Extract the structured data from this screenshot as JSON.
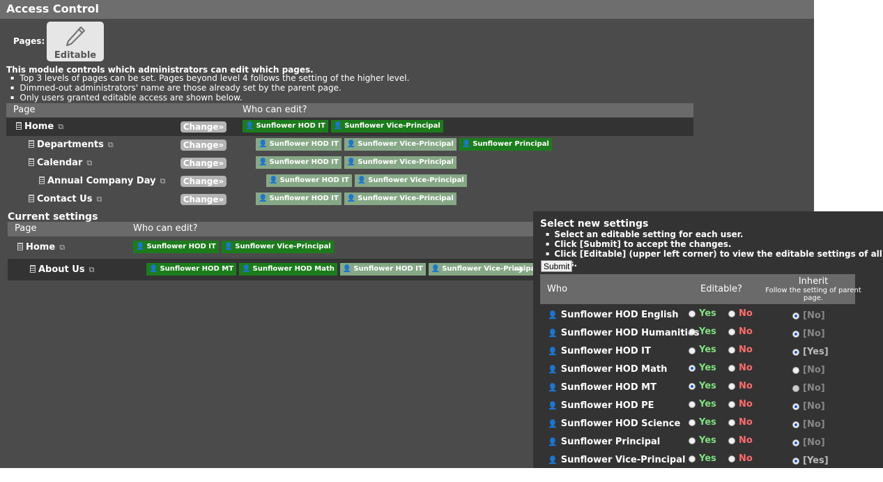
{
  "app": {
    "title": "Access Control"
  },
  "toolbar": {
    "pages_label": "Pages:",
    "editable_label": "Editable"
  },
  "intro": {
    "heading": "This module controls which administrators can edit which pages.",
    "bullets": [
      "Top 3 levels of pages can be set. Pages beyond level 4 follows the setting of the higher level.",
      "Dimmed-out administrators' name are those already set by the parent page.",
      "Only users granted editable access are shown below."
    ]
  },
  "pages_table": {
    "col_page": "Page",
    "col_who": "Who can edit?",
    "change_label": "Change»",
    "rows": [
      {
        "name": "Home",
        "tags": [
          {
            "label": "Sunflower HOD IT"
          },
          {
            "label": "Sunflower Vice-Principal"
          }
        ]
      },
      {
        "name": "Departments",
        "tags": [
          {
            "label": "Sunflower HOD IT"
          },
          {
            "label": "Sunflower Vice-Principal"
          },
          {
            "label": "Sunflower Principal"
          }
        ]
      },
      {
        "name": "Calendar",
        "tags": [
          {
            "label": "Sunflower HOD IT"
          },
          {
            "label": "Sunflower Vice-Principal"
          }
        ]
      },
      {
        "name": "Annual Company Day",
        "tags": [
          {
            "label": "Sunflower HOD IT"
          },
          {
            "label": "Sunflower Vice-Principal"
          }
        ]
      },
      {
        "name": "Contact Us",
        "tags": [
          {
            "label": "Sunflower HOD IT"
          },
          {
            "label": "Sunflower Vice-Principal"
          }
        ]
      }
    ]
  },
  "current": {
    "title": "Current settings",
    "col_page": "Page",
    "col_who": "Who can edit?",
    "rows": [
      {
        "name": "Home",
        "tags": [
          {
            "label": "Sunflower HOD IT"
          },
          {
            "label": "Sunflower Vice-Principal"
          }
        ]
      },
      {
        "name": "About Us",
        "tags": [
          {
            "label": "Sunflower HOD MT"
          },
          {
            "label": "Sunflower HOD Math"
          },
          {
            "label": "Sunflower HOD IT"
          },
          {
            "label": "Sunflower Vice-Principal"
          }
        ]
      }
    ]
  },
  "panel": {
    "title": "Select new settings",
    "bullets": [
      "Select an editable setting for each user.",
      "Click [Submit] to accept the changes.",
      "Click [Editable] (upper left corner) to view the editable settings of all pages."
    ],
    "submit_label": "Submit",
    "col_who": "Who",
    "col_editable": "Editable?",
    "col_inherit": "Inherit",
    "col_inherit_sub": "Follow the setting of parent page.",
    "yes_label": "Yes",
    "no_label": "No",
    "users": [
      {
        "name": "Sunflower HOD English",
        "inherit_value": "[No]"
      },
      {
        "name": "Sunflower HOD Humanities",
        "inherit_value": "[No]"
      },
      {
        "name": "Sunflower HOD IT",
        "inherit_value": "[Yes]"
      },
      {
        "name": "Sunflower HOD Math",
        "inherit_value": "[No]"
      },
      {
        "name": "Sunflower HOD MT",
        "inherit_value": "[No]"
      },
      {
        "name": "Sunflower HOD PE",
        "inherit_value": "[No]"
      },
      {
        "name": "Sunflower HOD Science",
        "inherit_value": "[No]"
      },
      {
        "name": "Sunflower Principal",
        "inherit_value": "[No]"
      },
      {
        "name": "Sunflower Vice-Principal",
        "inherit_value": "[Yes]"
      }
    ]
  }
}
